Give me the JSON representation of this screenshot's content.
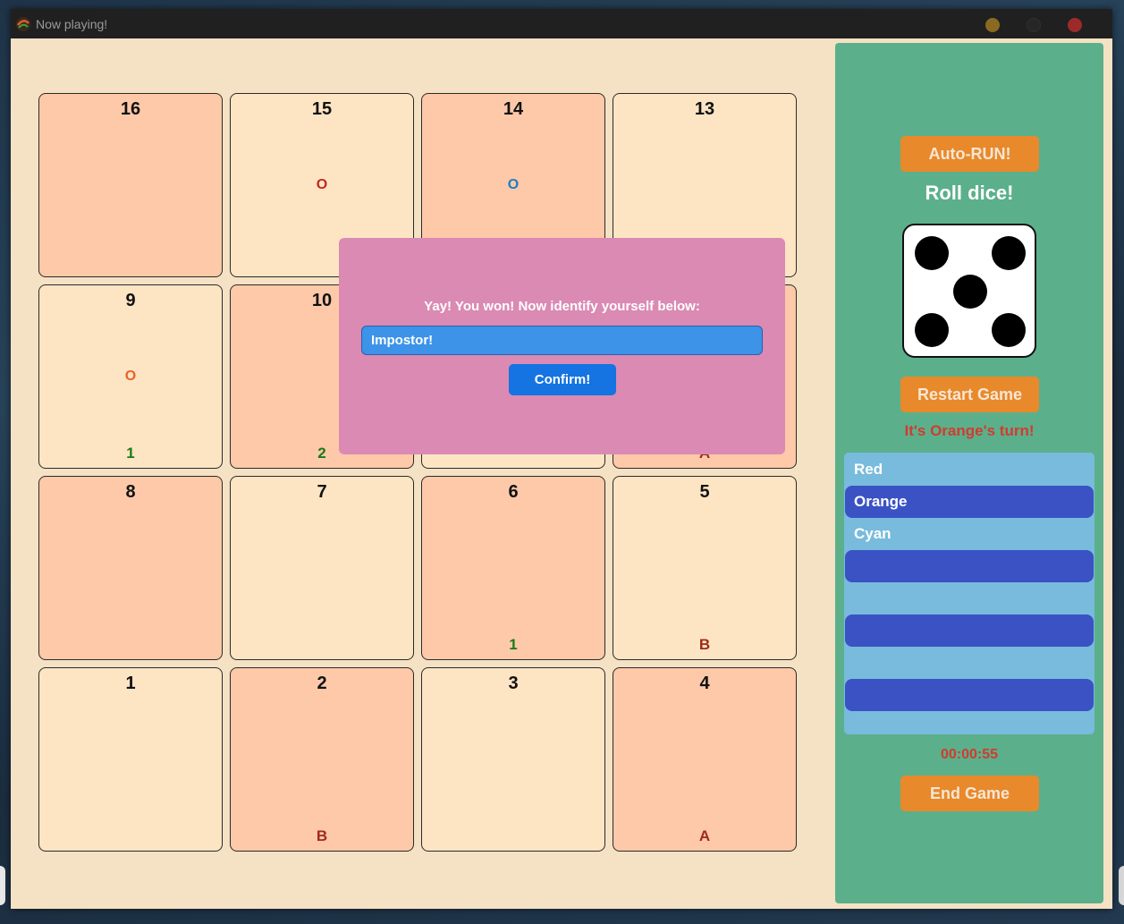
{
  "window": {
    "title": "Now playing!"
  },
  "board": {
    "cells": [
      {
        "num": "16",
        "shade": "dark",
        "piece": "",
        "piece_color": "",
        "bottom": "",
        "bottom_color": ""
      },
      {
        "num": "15",
        "shade": "light",
        "piece": "O",
        "piece_color": "#c0281e",
        "bottom": "",
        "bottom_color": ""
      },
      {
        "num": "14",
        "shade": "dark",
        "piece": "O",
        "piece_color": "#1c7fc0",
        "bottom": "",
        "bottom_color": ""
      },
      {
        "num": "13",
        "shade": "light",
        "piece": "",
        "piece_color": "",
        "bottom": "",
        "bottom_color": ""
      },
      {
        "num": "9",
        "shade": "light",
        "piece": "O",
        "piece_color": "#e8622a",
        "bottom": "1",
        "bottom_color": "#1a7a1a"
      },
      {
        "num": "10",
        "shade": "dark",
        "piece": "",
        "piece_color": "",
        "bottom": "2",
        "bottom_color": "#1a7a1a"
      },
      {
        "num": "",
        "shade": "light",
        "piece": "",
        "piece_color": "",
        "bottom": "",
        "bottom_color": ""
      },
      {
        "num": "",
        "shade": "dark",
        "piece": "",
        "piece_color": "",
        "bottom": "A",
        "bottom_color": "#a12a1a"
      },
      {
        "num": "8",
        "shade": "dark",
        "piece": "",
        "piece_color": "",
        "bottom": "",
        "bottom_color": ""
      },
      {
        "num": "7",
        "shade": "light",
        "piece": "",
        "piece_color": "",
        "bottom": "",
        "bottom_color": ""
      },
      {
        "num": "6",
        "shade": "dark",
        "piece": "",
        "piece_color": "",
        "bottom": "1",
        "bottom_color": "#1a7a1a"
      },
      {
        "num": "5",
        "shade": "light",
        "piece": "",
        "piece_color": "",
        "bottom": "B",
        "bottom_color": "#a12a1a"
      },
      {
        "num": "1",
        "shade": "light",
        "piece": "",
        "piece_color": "",
        "bottom": "",
        "bottom_color": ""
      },
      {
        "num": "2",
        "shade": "dark",
        "piece": "",
        "piece_color": "",
        "bottom": "B",
        "bottom_color": "#a12a1a"
      },
      {
        "num": "3",
        "shade": "light",
        "piece": "",
        "piece_color": "",
        "bottom": "",
        "bottom_color": ""
      },
      {
        "num": "4",
        "shade": "dark",
        "piece": "",
        "piece_color": "",
        "bottom": "A",
        "bottom_color": "#a12a1a"
      }
    ]
  },
  "modal": {
    "message": "Yay! You won! Now identify yourself below:",
    "input_value": "Impostor!",
    "confirm_label": "Confirm!"
  },
  "panel": {
    "auto_run_label": "Auto-RUN!",
    "roll_text": "Roll dice!",
    "dice_value": 5,
    "restart_label": "Restart Game",
    "turn_text": "It's Orange's turn!",
    "players": [
      {
        "name": "Red",
        "active": false
      },
      {
        "name": "Orange",
        "active": true
      },
      {
        "name": "Cyan",
        "active": false
      },
      {
        "name": "",
        "active": true
      },
      {
        "name": "",
        "active": false
      },
      {
        "name": "",
        "active": true
      },
      {
        "name": "",
        "active": false
      },
      {
        "name": "",
        "active": true
      }
    ],
    "timer": "00:00:55",
    "end_label": "End Game"
  },
  "colors": {
    "board_bg": "#f5e1c3",
    "cell_light": "#fde5c4",
    "cell_dark": "#fdc9a9",
    "panel_bg": "#5bb08b",
    "button_orange": "#e8892b",
    "modal_bg": "#da8ab3",
    "player_active": "#3a52c4",
    "player_list_bg": "#78bbdc",
    "turn_text": "#d23b2f"
  }
}
